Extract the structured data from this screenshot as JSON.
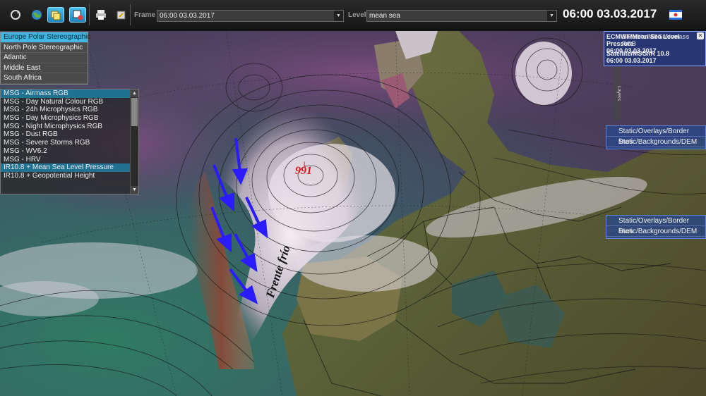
{
  "toolbar": {
    "frame_label": "Frame",
    "frame_value": "06:00 03.03.2017",
    "level_label": "Level",
    "level_value": "mean sea",
    "datetime": "06:00 03.03.2017",
    "icons": [
      "refresh-icon",
      "globe-icon",
      "layers-icon",
      "map-settings-icon",
      "print-icon",
      "export-icon",
      "flag-icon"
    ]
  },
  "projections": {
    "items": [
      {
        "label": "Europe Polar Stereographic",
        "selected": true
      },
      {
        "label": "North Pole Stereographic",
        "selected": false
      },
      {
        "label": "Atlantic",
        "selected": false
      },
      {
        "label": "Middle East",
        "selected": false
      },
      {
        "label": "South Africa",
        "selected": false
      }
    ]
  },
  "products": {
    "items": [
      {
        "label": "MSG - Airmass RGB",
        "ghost": "",
        "selected": true
      },
      {
        "label": "MSG - Day Natural Colour RGB",
        "ghost": "",
        "selected": false
      },
      {
        "label": "MSG - 24h Microphysics RGB",
        "ghost": "",
        "selected": false
      },
      {
        "label": "MSG - Day Microphysics RGB",
        "ghost": "",
        "selected": false
      },
      {
        "label": "MSG - Night Microphysics RGB",
        "ghost": "",
        "selected": false
      },
      {
        "label": "MSG - Dust RGB",
        "ghost": "",
        "selected": false
      },
      {
        "label": "MSG - Severe Storms RGB",
        "ghost": "",
        "selected": false
      },
      {
        "label": "MSG - WV6.2",
        "ghost": "",
        "selected": false
      },
      {
        "label": "MSG - HRV",
        "ghost": "",
        "selected": false
      },
      {
        "label": "IR10.8 + Mean Sea Level Pressure",
        "ghost": "",
        "selected": true
      },
      {
        "label": "IR10.8 + Geopotential Height",
        "ghost": "",
        "selected": false
      }
    ]
  },
  "layers": {
    "rows": [
      {
        "title": "ECMWF/Mean Sea Level Pressure",
        "ghost": "Satellite/MSG/Airmass RGB",
        "time": "06:00 03.03.2017"
      },
      {
        "title": "Satellite/MSG/IR 10.8",
        "ghost": "",
        "time": "06:00 03.03.2017"
      }
    ],
    "tab_label": "Layers"
  },
  "background_panels": [
    {
      "items": [
        "Static/Overlays/Border lines",
        "Static/Backgrounds/DEM"
      ]
    },
    {
      "items": [
        "Static/Overlays/Border lines",
        "Static/Backgrounds/DEM"
      ]
    }
  ],
  "annotations": {
    "pressure_center": "991",
    "front_label": "Frente frío",
    "colors": {
      "pressure_center": "#e0141a",
      "arrows": "#2a1cff",
      "front_label": "#111111"
    }
  },
  "map": {
    "colors": {
      "ocean_low": "#2c6e5a",
      "cloud_white": "#e8e4ea",
      "airmass_purple": "#6a4b6f",
      "warm_brown": "#7a4330",
      "land_olive": "#5f6130"
    }
  }
}
